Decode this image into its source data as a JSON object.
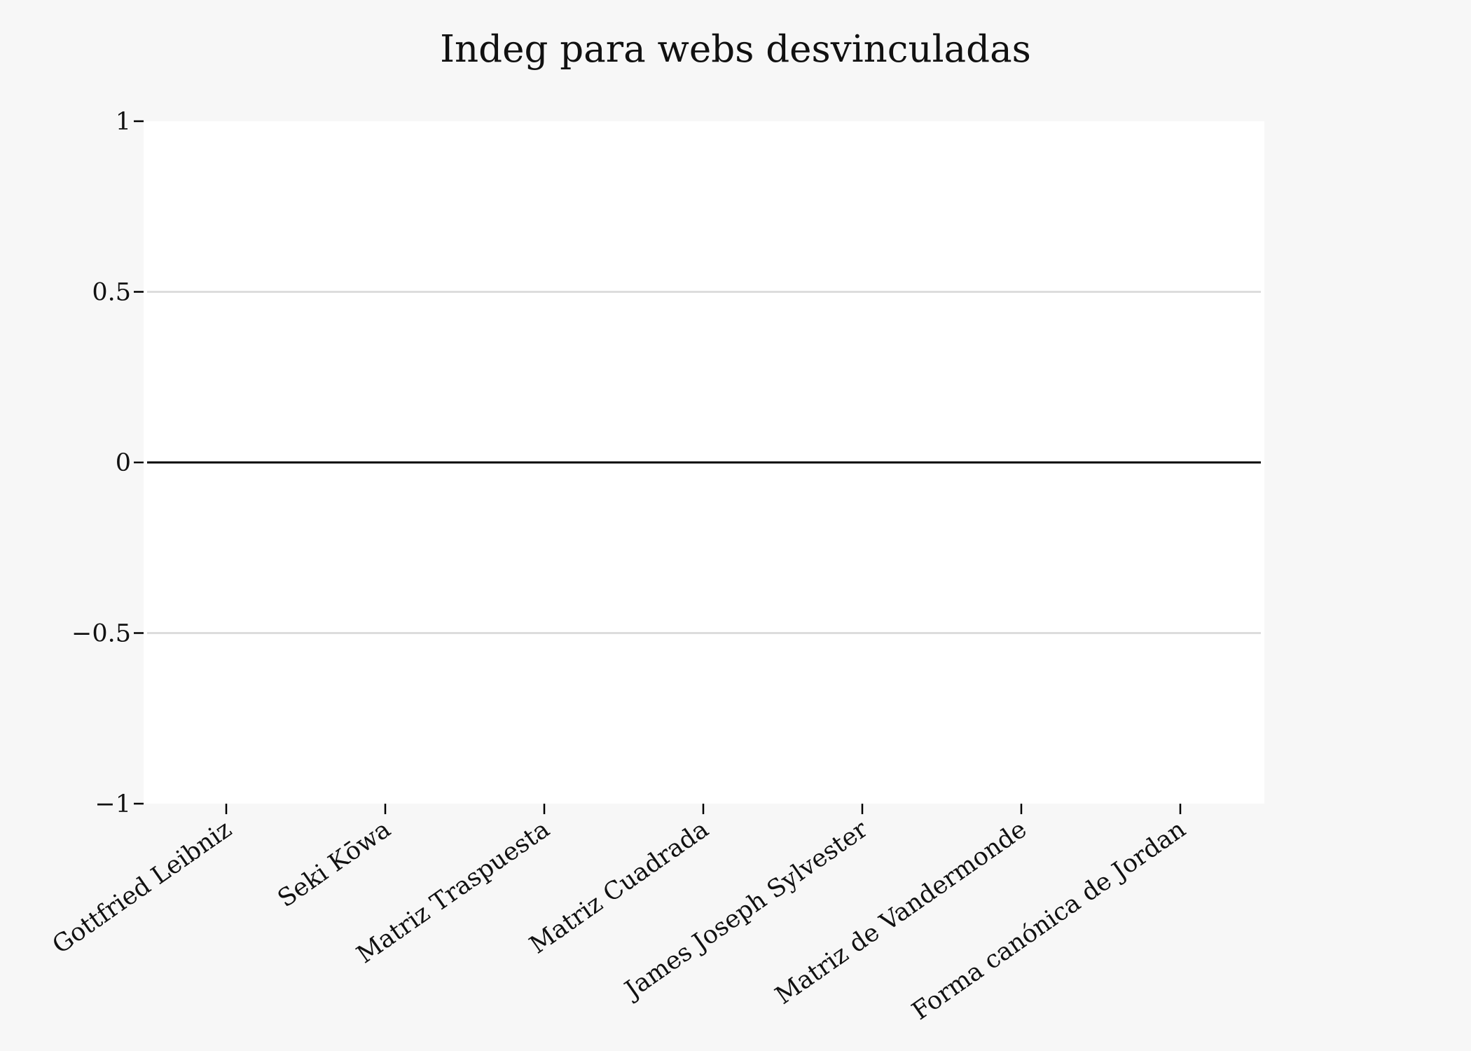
{
  "chart_data": {
    "type": "bar",
    "title": "Indeg para webs desvinculadas",
    "xlabel": "",
    "ylabel": "",
    "categories": [
      "Gottfried Leibniz",
      "Seki Kōwa",
      "Matriz Traspuesta",
      "Matriz Cuadrada",
      "James Joseph Sylvester",
      "Matriz de Vandermonde",
      "Forma canónica de Jordan"
    ],
    "series": [
      {
        "values": [
          0,
          0,
          0,
          0,
          0,
          0,
          0
        ]
      }
    ],
    "ylim": [
      -1,
      1
    ],
    "yticks": [
      -1,
      -0.5,
      0,
      0.5,
      1
    ],
    "ytick_labels": [
      "−1",
      "−0.5",
      "0",
      "0.5",
      "1"
    ],
    "grid": "horizontal",
    "legend": "none",
    "colors": {
      "figure_background": "#f7f7f7",
      "plot_background": "#ffffff",
      "gridline": "#dddddd",
      "zero_line": "#000000",
      "text": "#111111"
    }
  }
}
